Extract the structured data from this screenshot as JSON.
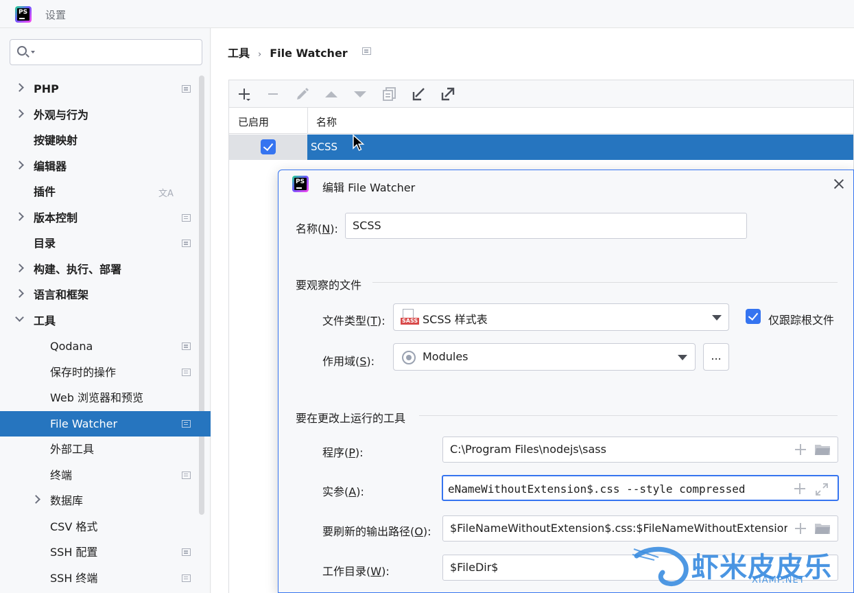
{
  "window": {
    "title": "设置",
    "app_icon": "phpstorm-icon",
    "app_icon_text": "PS"
  },
  "sidebar": {
    "search_placeholder": "",
    "items": [
      {
        "label": "PHP",
        "expandable": true,
        "bold": true,
        "icon": "page-icon"
      },
      {
        "label": "外观与行为",
        "expandable": true,
        "bold": true,
        "icon": ""
      },
      {
        "label": "按键映射",
        "expandable": false,
        "bold": true,
        "icon": ""
      },
      {
        "label": "编辑器",
        "expandable": true,
        "bold": true,
        "icon": ""
      },
      {
        "label": "插件",
        "expandable": false,
        "bold": true,
        "icon": "translate-icon"
      },
      {
        "label": "版本控制",
        "expandable": true,
        "bold": true,
        "icon": "page-icon"
      },
      {
        "label": "目录",
        "expandable": false,
        "bold": true,
        "icon": "page-icon"
      },
      {
        "label": "构建、执行、部署",
        "expandable": true,
        "bold": true,
        "icon": ""
      },
      {
        "label": "语言和框架",
        "expandable": true,
        "bold": true,
        "icon": ""
      },
      {
        "label": "工具",
        "expandable": true,
        "expanded": true,
        "bold": true,
        "icon": ""
      },
      {
        "label": "Qodana",
        "child": true,
        "icon": "page-icon"
      },
      {
        "label": "保存时的操作",
        "child": true,
        "icon": "page-icon"
      },
      {
        "label": "Web 浏览器和预览",
        "child": true,
        "icon": ""
      },
      {
        "label": "File Watcher",
        "child": true,
        "selected": true,
        "icon": "page-icon"
      },
      {
        "label": "外部工具",
        "child": true,
        "icon": ""
      },
      {
        "label": "终端",
        "child": true,
        "icon": "page-icon"
      },
      {
        "label": "数据库",
        "child": true,
        "expandable": true,
        "icon": ""
      },
      {
        "label": "CSV 格式",
        "child": true,
        "icon": ""
      },
      {
        "label": "SSH 配置",
        "child": true,
        "icon": "page-icon"
      },
      {
        "label": "SSH 终端",
        "child": true,
        "icon": "page-icon"
      }
    ]
  },
  "main": {
    "breadcrumb": [
      "工具",
      "File Watcher"
    ],
    "toolbar_icons": [
      "add-icon",
      "remove-icon",
      "edit-icon",
      "move-up-icon",
      "move-down-icon",
      "copy-icon",
      "import-icon",
      "export-icon"
    ],
    "table": {
      "columns": [
        "已启用",
        "名称"
      ],
      "rows": [
        {
          "enabled": true,
          "name": "SCSS"
        }
      ]
    }
  },
  "dialog": {
    "title": "编辑 File Watcher",
    "name_label": "名称(",
    "name_mnemonic": "N",
    "name_label_end": "):",
    "name_value": "SCSS",
    "section_files": "要观察的文件",
    "file_type_label": "文件类型(",
    "file_type_mnemonic": "T",
    "file_type_label_end": "):",
    "file_type_value": "SCSS 样式表",
    "file_type_icon_text": "SASS",
    "track_root_label": "仅跟踪根文件",
    "track_root_checked": true,
    "scope_label": "作用域(",
    "scope_mnemonic": "S",
    "scope_label_end": "):",
    "scope_value": "Modules",
    "scope_more": "...",
    "section_tool": "要在更改上运行的工具",
    "program_label": "程序(",
    "program_mnemonic": "P",
    "program_label_end": "):",
    "program_value": "C:\\Program Files\\nodejs\\sass",
    "args_label": "实参(",
    "args_mnemonic": "A",
    "args_label_end": "):",
    "args_value": "eNameWithoutExtension$.css --style compressed",
    "output_label": "要刷新的输出路径(",
    "output_mnemonic": "O",
    "output_label_end": "):",
    "output_value": "$FileNameWithoutExtension$.css:$FileNameWithoutExtension",
    "workdir_label": "工作目录(",
    "workdir_mnemonic": "W",
    "workdir_label_end": "):",
    "workdir_value": "$FileDir$"
  },
  "watermark": {
    "text": "虾米皮皮乐",
    "sub": "XIAMP.NET"
  },
  "colors": {
    "accent": "#2675bf",
    "checkbox": "#3574f0",
    "watermark": "#3b8de0"
  }
}
